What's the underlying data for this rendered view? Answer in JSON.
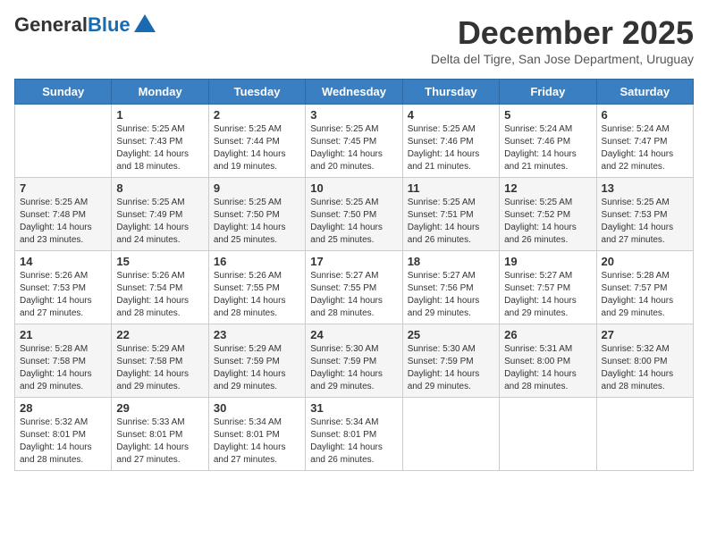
{
  "logo": {
    "line1": "General",
    "line2": "Blue"
  },
  "title": "December 2025",
  "subtitle": "Delta del Tigre, San Jose Department, Uruguay",
  "days_of_week": [
    "Sunday",
    "Monday",
    "Tuesday",
    "Wednesday",
    "Thursday",
    "Friday",
    "Saturday"
  ],
  "weeks": [
    [
      {
        "num": "",
        "info": ""
      },
      {
        "num": "1",
        "info": "Sunrise: 5:25 AM\nSunset: 7:43 PM\nDaylight: 14 hours\nand 18 minutes."
      },
      {
        "num": "2",
        "info": "Sunrise: 5:25 AM\nSunset: 7:44 PM\nDaylight: 14 hours\nand 19 minutes."
      },
      {
        "num": "3",
        "info": "Sunrise: 5:25 AM\nSunset: 7:45 PM\nDaylight: 14 hours\nand 20 minutes."
      },
      {
        "num": "4",
        "info": "Sunrise: 5:25 AM\nSunset: 7:46 PM\nDaylight: 14 hours\nand 21 minutes."
      },
      {
        "num": "5",
        "info": "Sunrise: 5:24 AM\nSunset: 7:46 PM\nDaylight: 14 hours\nand 21 minutes."
      },
      {
        "num": "6",
        "info": "Sunrise: 5:24 AM\nSunset: 7:47 PM\nDaylight: 14 hours\nand 22 minutes."
      }
    ],
    [
      {
        "num": "7",
        "info": "Sunrise: 5:25 AM\nSunset: 7:48 PM\nDaylight: 14 hours\nand 23 minutes."
      },
      {
        "num": "8",
        "info": "Sunrise: 5:25 AM\nSunset: 7:49 PM\nDaylight: 14 hours\nand 24 minutes."
      },
      {
        "num": "9",
        "info": "Sunrise: 5:25 AM\nSunset: 7:50 PM\nDaylight: 14 hours\nand 25 minutes."
      },
      {
        "num": "10",
        "info": "Sunrise: 5:25 AM\nSunset: 7:50 PM\nDaylight: 14 hours\nand 25 minutes."
      },
      {
        "num": "11",
        "info": "Sunrise: 5:25 AM\nSunset: 7:51 PM\nDaylight: 14 hours\nand 26 minutes."
      },
      {
        "num": "12",
        "info": "Sunrise: 5:25 AM\nSunset: 7:52 PM\nDaylight: 14 hours\nand 26 minutes."
      },
      {
        "num": "13",
        "info": "Sunrise: 5:25 AM\nSunset: 7:53 PM\nDaylight: 14 hours\nand 27 minutes."
      }
    ],
    [
      {
        "num": "14",
        "info": "Sunrise: 5:26 AM\nSunset: 7:53 PM\nDaylight: 14 hours\nand 27 minutes."
      },
      {
        "num": "15",
        "info": "Sunrise: 5:26 AM\nSunset: 7:54 PM\nDaylight: 14 hours\nand 28 minutes."
      },
      {
        "num": "16",
        "info": "Sunrise: 5:26 AM\nSunset: 7:55 PM\nDaylight: 14 hours\nand 28 minutes."
      },
      {
        "num": "17",
        "info": "Sunrise: 5:27 AM\nSunset: 7:55 PM\nDaylight: 14 hours\nand 28 minutes."
      },
      {
        "num": "18",
        "info": "Sunrise: 5:27 AM\nSunset: 7:56 PM\nDaylight: 14 hours\nand 29 minutes."
      },
      {
        "num": "19",
        "info": "Sunrise: 5:27 AM\nSunset: 7:57 PM\nDaylight: 14 hours\nand 29 minutes."
      },
      {
        "num": "20",
        "info": "Sunrise: 5:28 AM\nSunset: 7:57 PM\nDaylight: 14 hours\nand 29 minutes."
      }
    ],
    [
      {
        "num": "21",
        "info": "Sunrise: 5:28 AM\nSunset: 7:58 PM\nDaylight: 14 hours\nand 29 minutes."
      },
      {
        "num": "22",
        "info": "Sunrise: 5:29 AM\nSunset: 7:58 PM\nDaylight: 14 hours\nand 29 minutes."
      },
      {
        "num": "23",
        "info": "Sunrise: 5:29 AM\nSunset: 7:59 PM\nDaylight: 14 hours\nand 29 minutes."
      },
      {
        "num": "24",
        "info": "Sunrise: 5:30 AM\nSunset: 7:59 PM\nDaylight: 14 hours\nand 29 minutes."
      },
      {
        "num": "25",
        "info": "Sunrise: 5:30 AM\nSunset: 7:59 PM\nDaylight: 14 hours\nand 29 minutes."
      },
      {
        "num": "26",
        "info": "Sunrise: 5:31 AM\nSunset: 8:00 PM\nDaylight: 14 hours\nand 28 minutes."
      },
      {
        "num": "27",
        "info": "Sunrise: 5:32 AM\nSunset: 8:00 PM\nDaylight: 14 hours\nand 28 minutes."
      }
    ],
    [
      {
        "num": "28",
        "info": "Sunrise: 5:32 AM\nSunset: 8:01 PM\nDaylight: 14 hours\nand 28 minutes."
      },
      {
        "num": "29",
        "info": "Sunrise: 5:33 AM\nSunset: 8:01 PM\nDaylight: 14 hours\nand 27 minutes."
      },
      {
        "num": "30",
        "info": "Sunrise: 5:34 AM\nSunset: 8:01 PM\nDaylight: 14 hours\nand 27 minutes."
      },
      {
        "num": "31",
        "info": "Sunrise: 5:34 AM\nSunset: 8:01 PM\nDaylight: 14 hours\nand 26 minutes."
      },
      {
        "num": "",
        "info": ""
      },
      {
        "num": "",
        "info": ""
      },
      {
        "num": "",
        "info": ""
      }
    ]
  ]
}
